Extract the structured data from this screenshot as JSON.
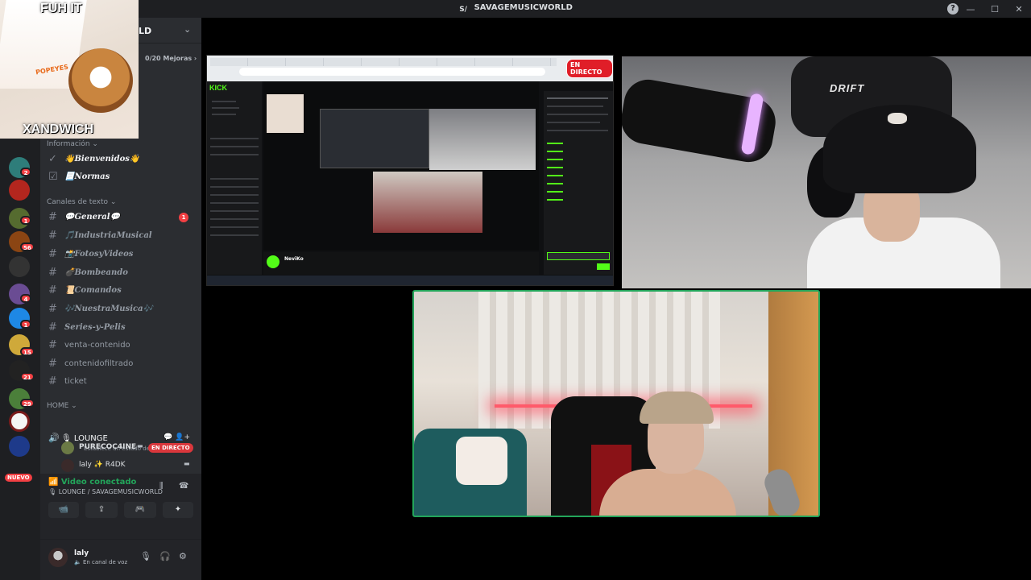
{
  "window": {
    "title": "SAVAGEMUSICWORLD",
    "server_glyph": "S/",
    "help": "?",
    "minimize": "—",
    "maximize": "☐",
    "close": "✕"
  },
  "overlay_meme": {
    "top_text": "FUH IT",
    "bottom_text": "XANDWICH",
    "bag_text": "POPEYES"
  },
  "server_header": {
    "name_fragment": "LD",
    "chevron": "⌄",
    "boost_text": "0/20 Mejoras ›"
  },
  "server_rail": {
    "badges": [
      "2",
      "1",
      "56",
      "4",
      "1",
      "15",
      "21",
      "29"
    ],
    "new_label": "NUEVO"
  },
  "categories": {
    "info": "Información ⌄",
    "text": "Canales de texto ⌄",
    "home": "HOME ⌄"
  },
  "channels": [
    {
      "label": "👋Bienvenidos👋",
      "fancy": true,
      "unread": true,
      "icon": "✓"
    },
    {
      "label": "📃Normas",
      "fancy": true,
      "unread": true,
      "icon": "☑"
    },
    {
      "label": "💬General💬",
      "fancy": true,
      "unread": true,
      "icon": "#",
      "mentions": "1"
    },
    {
      "label": "🎵IndustriaMusical",
      "fancy": true,
      "unread": false,
      "icon": "#"
    },
    {
      "label": "📸FotosyVideos",
      "fancy": true,
      "unread": false,
      "icon": "#"
    },
    {
      "label": "💣Bombeando",
      "fancy": true,
      "unread": false,
      "icon": "#"
    },
    {
      "label": "📜Comandos",
      "fancy": true,
      "unread": false,
      "icon": "#"
    },
    {
      "label": "🎶NuestraMusica🎶",
      "fancy": true,
      "unread": false,
      "icon": "#"
    },
    {
      "label": "Series-y-Pelis",
      "fancy": true,
      "unread": false,
      "icon": "#"
    },
    {
      "label": "venta-contenido",
      "fancy": false,
      "unread": false,
      "icon": "#"
    },
    {
      "label": "contenidofiltrado",
      "fancy": false,
      "unread": false,
      "icon": "#"
    },
    {
      "label": "ticket",
      "fancy": false,
      "unread": false,
      "icon": "#"
    }
  ],
  "voice_channel": {
    "speaker": "🔊",
    "name": "🎙 LOUNGE",
    "status": "Establece un estado de canal ✎",
    "icons": "💬 👤+",
    "users": [
      {
        "name": "PURECOC4INE",
        "live": "EN DIRECTO",
        "cam": "▬"
      },
      {
        "name": "laly ✨ R4DK",
        "cam": "▬"
      }
    ]
  },
  "rtc": {
    "state": "📶 Video conectado",
    "channel": "🎙 LOUNGE / SAVAGEMUSICWORLD",
    "wave_icon": "⫼",
    "disconnect_icon": "☎",
    "buttons": [
      "📹",
      "⇪",
      "🎮",
      "✦"
    ]
  },
  "user": {
    "name": "laly",
    "status": "🔈 En canal de voz",
    "mic": "🎙",
    "headset": "🎧",
    "settings": "⚙"
  },
  "screen_share": {
    "live_label": "EN DIRECTO",
    "kick_logo": "KICK",
    "streamer": "NeviKo"
  },
  "cam1": {
    "chair_brand": "DRIFT"
  }
}
